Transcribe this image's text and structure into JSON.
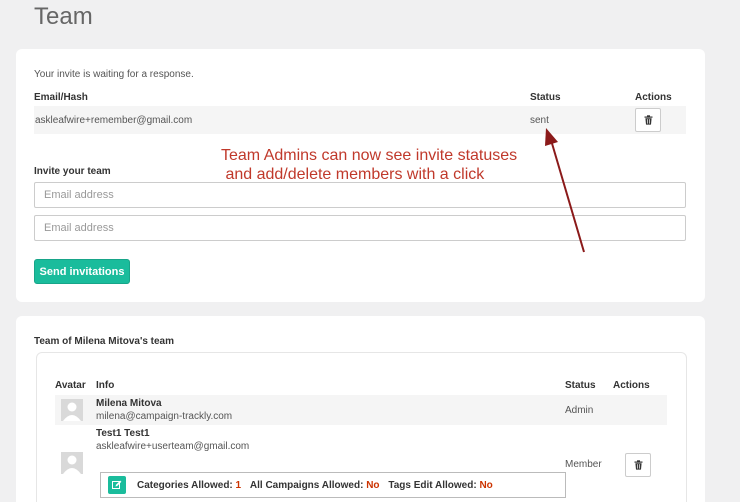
{
  "page": {
    "title": "Team"
  },
  "invites": {
    "waiting_text": "Your invite is waiting for a response.",
    "columns": {
      "email": "Email/Hash",
      "status": "Status",
      "actions": "Actions"
    },
    "rows": [
      {
        "email": "askleafwire+remember@gmail.com",
        "status": "sent"
      }
    ]
  },
  "invite_form": {
    "heading": "Invite your team",
    "email1_placeholder": "Email address",
    "email2_placeholder": "Email address",
    "send_label": "Send invitations"
  },
  "annotation": {
    "line1": "Team Admins can now see invite statuses",
    "line2": " and add/delete members with a click"
  },
  "team": {
    "heading": "Team of Milena Mitova's team",
    "columns": {
      "avatar": "Avatar",
      "info": "Info",
      "status": "Status",
      "actions": "Actions"
    },
    "members": [
      {
        "name": "Milena Mitova",
        "email": "milena@campaign-trackly.com",
        "status": "Admin"
      },
      {
        "name": "Test1 Test1",
        "email": "askleafwire+userteam@gmail.com",
        "status": "Member"
      }
    ],
    "permissions": {
      "categories_label": "Categories Allowed:",
      "categories_value": "1",
      "campaigns_label": "All Campaigns Allowed:",
      "campaigns_value": "No",
      "tags_label": "Tags Edit Allowed:",
      "tags_value": "No"
    }
  },
  "colors": {
    "accent": "#1abc9c",
    "annotation": "#c0392b",
    "value_red": "#cc3300",
    "arrow": "#8b1a1a"
  },
  "icons": {
    "delete": "trash-icon",
    "edit": "edit-icon",
    "avatar": "user-silhouette-icon"
  }
}
